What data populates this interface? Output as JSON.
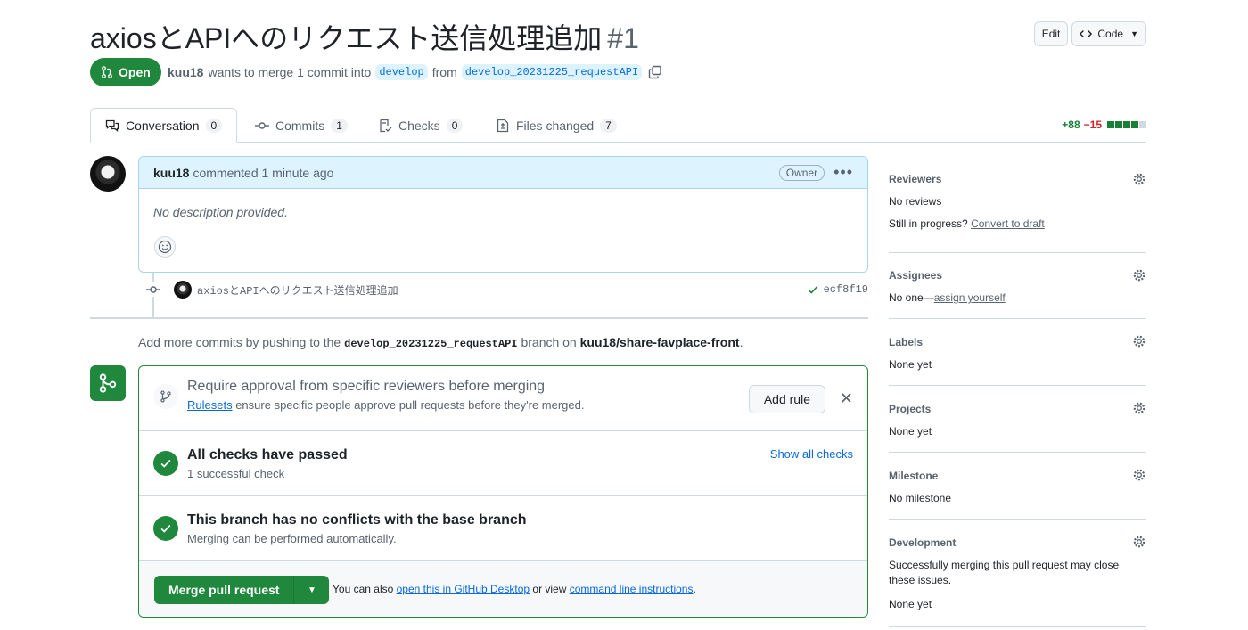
{
  "header": {
    "title": "axiosとAPIへのリクエスト送信処理追加",
    "number": "#1",
    "edit_label": "Edit",
    "code_label": "Code",
    "state_label": "Open",
    "author": "kuu18",
    "merge_text": "wants to merge 1 commit into",
    "base_branch": "develop",
    "from_text": "from",
    "head_branch": "develop_20231225_requestAPI"
  },
  "tabs": [
    {
      "label": "Conversation",
      "count": "0"
    },
    {
      "label": "Commits",
      "count": "1"
    },
    {
      "label": "Checks",
      "count": "0"
    },
    {
      "label": "Files changed",
      "count": "7"
    }
  ],
  "diffstat": {
    "additions": "+88",
    "deletions": "−15",
    "blocks": [
      "#1a7f37",
      "#1a7f37",
      "#1a7f37",
      "#1a7f37",
      "#d1d9e0"
    ]
  },
  "comment": {
    "author": "kuu18",
    "action": "commented 1 minute ago",
    "badge": "Owner",
    "body": "No description provided."
  },
  "commit": {
    "message": "axiosとAPIへのリクエスト送信処理追加",
    "sha": "ecf8f19"
  },
  "push_note": {
    "prefix": "Add more commits by pushing to the",
    "branch": "develop_20231225_requestAPI",
    "middle": "branch on",
    "repo": "kuu18/share-favplace-front",
    "suffix": "."
  },
  "mergebox": {
    "rule_title": "Require approval from specific reviewers before merging",
    "rule_link": "Rulesets",
    "rule_text": "ensure specific people approve pull requests before they're merged.",
    "add_rule": "Add rule",
    "checks_title": "All checks have passed",
    "checks_sub": "1 successful check",
    "show_checks": "Show all checks",
    "conflict_title": "This branch has no conflicts with the base branch",
    "conflict_sub": "Merging can be performed automatically.",
    "merge_button": "Merge pull request",
    "also_prefix": "You can also",
    "desktop_link": "open this in GitHub Desktop",
    "or_view": "or view",
    "cli_link": "command line instructions",
    "period": "."
  },
  "sidebar": {
    "reviewers": {
      "title": "Reviewers",
      "line1": "No reviews",
      "line2_prefix": "Still in progress?",
      "line2_link": "Convert to draft"
    },
    "assignees": {
      "title": "Assignees",
      "prefix": "No one—",
      "link": "assign yourself"
    },
    "labels": {
      "title": "Labels",
      "value": "None yet"
    },
    "projects": {
      "title": "Projects",
      "value": "None yet"
    },
    "milestone": {
      "title": "Milestone",
      "value": "No milestone"
    },
    "development": {
      "title": "Development",
      "text1": "Successfully merging this pull request may close",
      "text2": "these issues.",
      "value": "None yet"
    }
  },
  "colors": {
    "green": "#1f883d",
    "blue": "#0969da",
    "muted": "#59636e",
    "border": "#d1d9e0"
  }
}
